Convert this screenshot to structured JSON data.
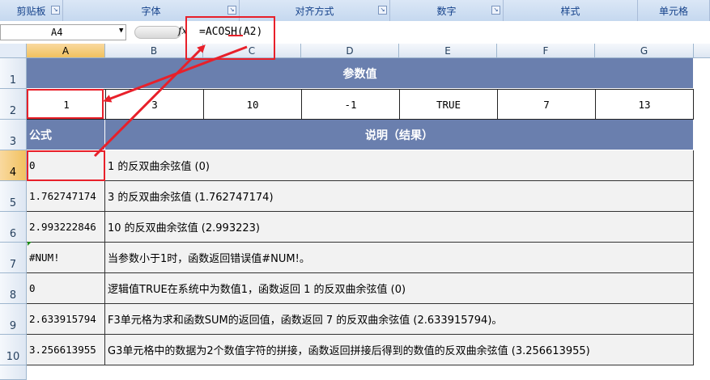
{
  "ribbon": {
    "groups": [
      {
        "label": "剪贴板"
      },
      {
        "label": "字体"
      },
      {
        "label": "对齐方式"
      },
      {
        "label": "数字"
      },
      {
        "label": "样式"
      },
      {
        "label": "单元格"
      }
    ],
    "launcher_glyph": "↘"
  },
  "formula_bar": {
    "name_box": "A4",
    "fx_label": "fx",
    "formula": "=ACOSH(A2)"
  },
  "columns": [
    "A",
    "B",
    "C",
    "D",
    "E",
    "F",
    "G"
  ],
  "rows": [
    "1",
    "2",
    "3",
    "4",
    "5",
    "6",
    "7",
    "8",
    "9",
    "10"
  ],
  "sheet": {
    "title": "参数值",
    "params": [
      "1",
      "3",
      "10",
      "-1",
      "TRUE",
      "7",
      "13"
    ],
    "formula_header": "公式",
    "desc_header": "说明（结果）",
    "results": [
      {
        "value": "0",
        "desc": "1 的反双曲余弦值 (0)"
      },
      {
        "value": "1.762747174",
        "desc": "3 的反双曲余弦值 (1.762747174)"
      },
      {
        "value": "2.993222846",
        "desc": "10 的反双曲余弦值 (2.993223)"
      },
      {
        "value": "#NUM!",
        "desc": "当参数小于1时，函数返回错误值#NUM!。"
      },
      {
        "value": "0",
        "desc": "逻辑值TRUE在系统中为数值1，函数返回 1 的反双曲余弦值 (0)"
      },
      {
        "value": "2.633915794",
        "desc": "F3单元格为求和函数SUM的返回值，函数返回 7 的反双曲余弦值 (2.633915794)。"
      },
      {
        "value": "3.256613955",
        "desc": "G3单元格中的数据为2个数值字符的拼接，函数返回拼接后得到的数值的反双曲余弦值 (3.256613955)"
      }
    ]
  },
  "colors": {
    "header_band": "#6a7fae",
    "annotation": "#e8202a"
  }
}
